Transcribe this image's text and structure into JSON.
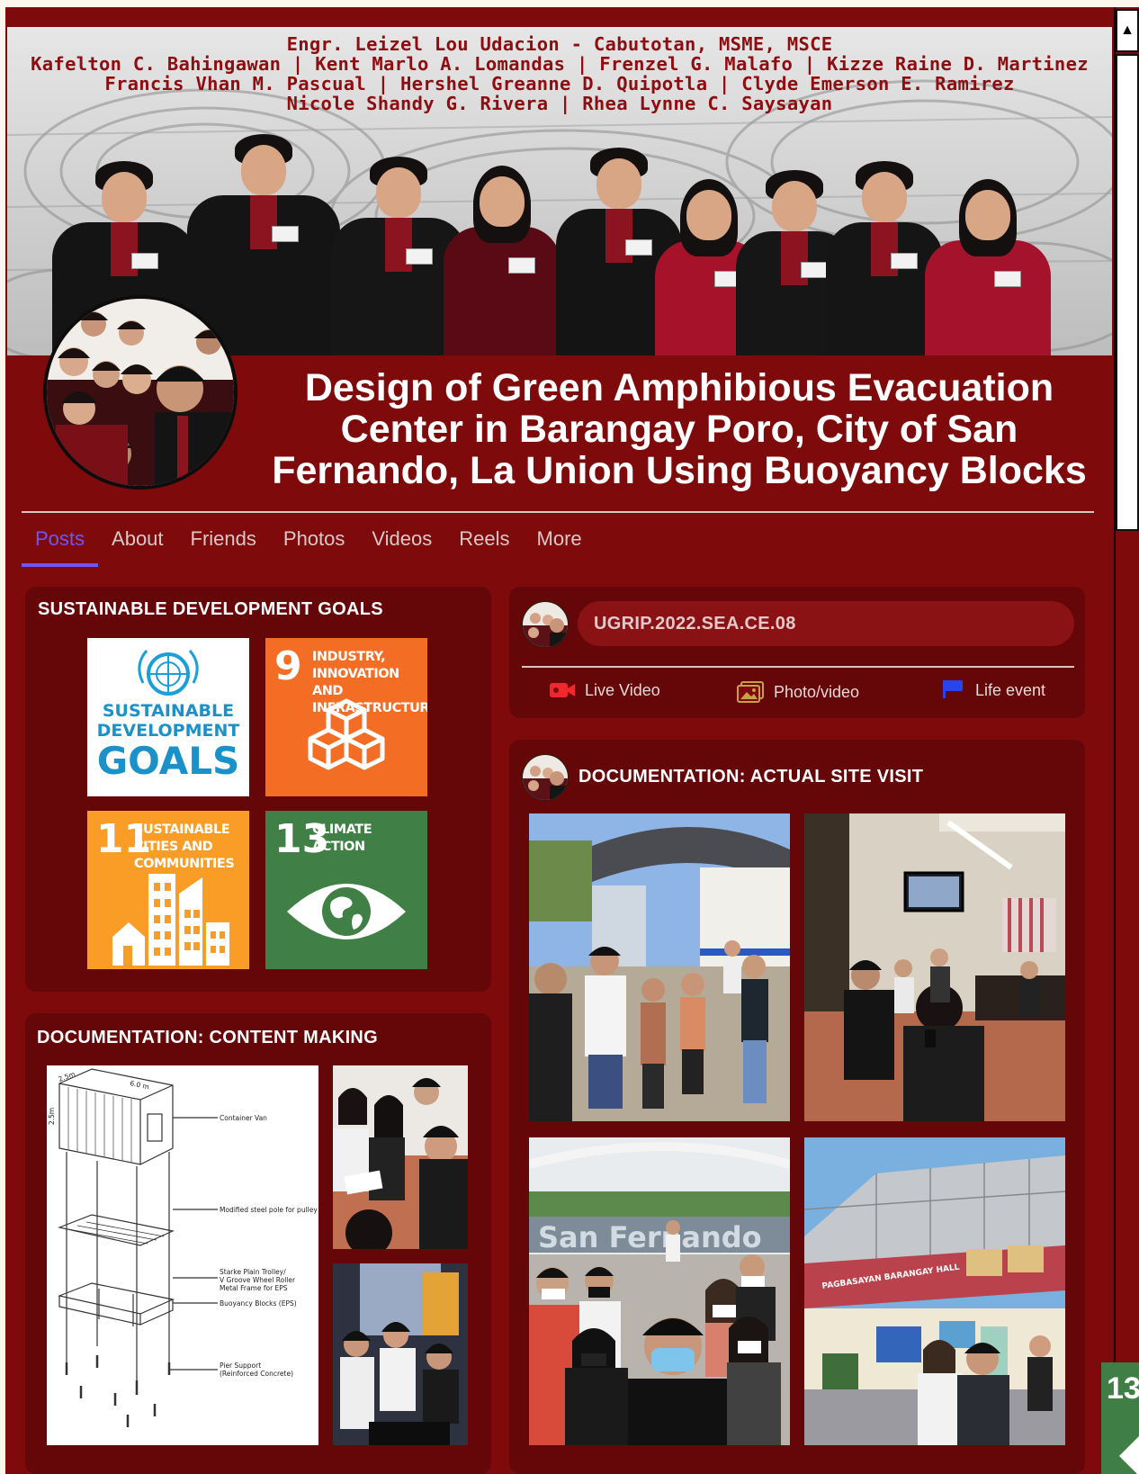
{
  "cover": {
    "credits": [
      "Engr. Leizel Lou Udacion - Cabutotan, MSME, MSCE",
      "Kafelton C. Bahingawan | Kent Marlo A. Lomandas | Frenzel G. Malafo | Kizze Raine D. Martinez",
      "Francis Vhan M. Pascual | Hershel Greanne D. Quipotla | Clyde Emerson E. Ramirez",
      "Nicole Shandy G. Rivera | Rhea Lynne C. Saysayan"
    ]
  },
  "profile": {
    "title_lines": [
      "Design of Green Amphibious Evacuation",
      "Center in Barangay Poro, City of San",
      "Fernando, La Union Using Buoyancy Blocks"
    ]
  },
  "tabs": [
    {
      "label": "Posts",
      "active": true
    },
    {
      "label": "About"
    },
    {
      "label": "Friends"
    },
    {
      "label": "Photos"
    },
    {
      "label": "Videos"
    },
    {
      "label": "Reels"
    },
    {
      "label": "More"
    }
  ],
  "sdg_card": {
    "title": "SUSTAINABLE DEVELOPMENT GOALS",
    "logo_lines": [
      "SUSTAINABLE",
      "DEVELOPMENT",
      "GOALS"
    ],
    "tiles": [
      {
        "number": "9",
        "label": "INDUSTRY, INNOVATION AND INFRASTRUCTURE",
        "color": "#f36d25"
      },
      {
        "number": "11",
        "label": "SUSTAINABLE CITIES AND COMMUNITIES",
        "color": "#f99d26"
      },
      {
        "number": "13",
        "label": "CLIMATE ACTION",
        "color": "#407f46"
      }
    ]
  },
  "content_card": {
    "title": "DOCUMENTATION: CONTENT MAKING",
    "diagram": {
      "dims": [
        "2.5m",
        "6.0 m",
        "2.5m"
      ],
      "labels": [
        "Container Van",
        "Modified steel pole for pulley",
        "Starke Plain Trolley/",
        "V Groove Wheel Roller",
        "Metal Frame for EPS",
        "Buoyancy Blocks (EPS)",
        "Pier Support",
        "(Reinforced Concrete)"
      ]
    }
  },
  "composer": {
    "placeholder": "UGRIP.2022.SEA.CE.08",
    "actions": [
      {
        "label": "Live Video",
        "icon": "video-camera-icon"
      },
      {
        "label": "Photo/video",
        "icon": "photo-icon"
      },
      {
        "label": "Life event",
        "icon": "flag-icon"
      }
    ]
  },
  "site_card": {
    "title": "DOCUMENTATION: ACTUAL SITE VISIT",
    "sign_text": "San Fernando",
    "hall_sign": "PAGBASAYAN BARANGAY HALL"
  },
  "badge": {
    "number": "13"
  },
  "colors": {
    "background": "#7e0a0c",
    "card": "#650608",
    "active_tab": "#6e55f5"
  }
}
